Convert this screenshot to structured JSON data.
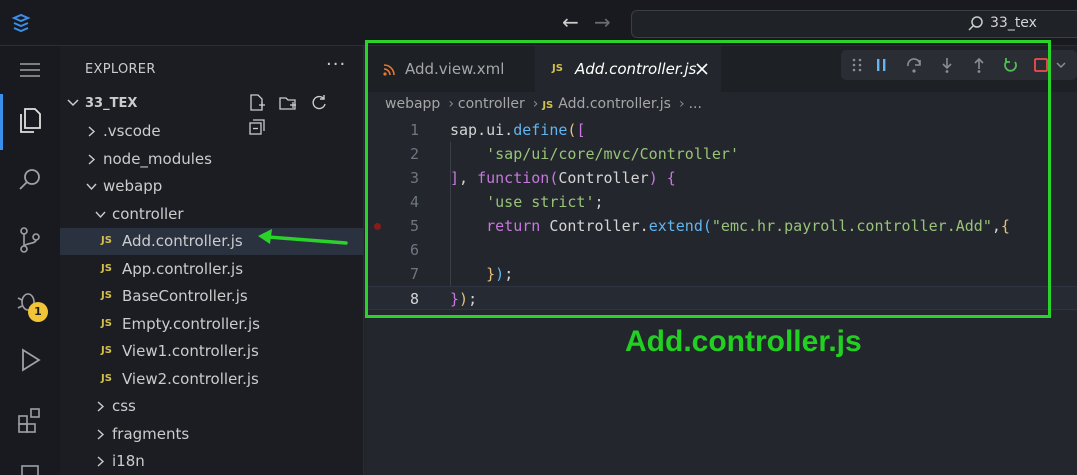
{
  "titlebar": {
    "search_text": "33_tex"
  },
  "activity": {
    "debug_badge": "1"
  },
  "sidebar": {
    "title": "EXPLORER",
    "more": "···",
    "workspace": "33_TEX",
    "tree": [
      {
        "label": ".vscode",
        "type": "folder",
        "expanded": false
      },
      {
        "label": "node_modules",
        "type": "folder",
        "expanded": false
      },
      {
        "label": "webapp",
        "type": "folder",
        "expanded": true
      },
      {
        "label": "controller",
        "type": "folder",
        "expanded": true
      },
      {
        "label": "Add.controller.js",
        "type": "js",
        "selected": true
      },
      {
        "label": "App.controller.js",
        "type": "js"
      },
      {
        "label": "BaseController.js",
        "type": "js"
      },
      {
        "label": "Empty.controller.js",
        "type": "js"
      },
      {
        "label": "View1.controller.js",
        "type": "js"
      },
      {
        "label": "View2.controller.js",
        "type": "js"
      },
      {
        "label": "css",
        "type": "folder",
        "expanded": false
      },
      {
        "label": "fragments",
        "type": "folder",
        "expanded": false
      },
      {
        "label": "i18n",
        "type": "folder",
        "expanded": false
      }
    ],
    "js_badge": "JS"
  },
  "editor": {
    "tabs": [
      {
        "label": "Add.view.xml",
        "active": false
      },
      {
        "label": "Add.controller.js",
        "active": true
      }
    ],
    "breadcrumb": [
      "webapp",
      "controller",
      "Add.controller.js",
      "..."
    ],
    "line_numbers": [
      "1",
      "2",
      "3",
      "4",
      "5",
      "6",
      "7",
      "8"
    ]
  },
  "annotation": {
    "caption": "Add.controller.js",
    "box_color": "#2ad32a"
  },
  "colors": {
    "accent": "#3b8eea",
    "badge": "#f2c438",
    "js_icon": "#d3c14d"
  }
}
